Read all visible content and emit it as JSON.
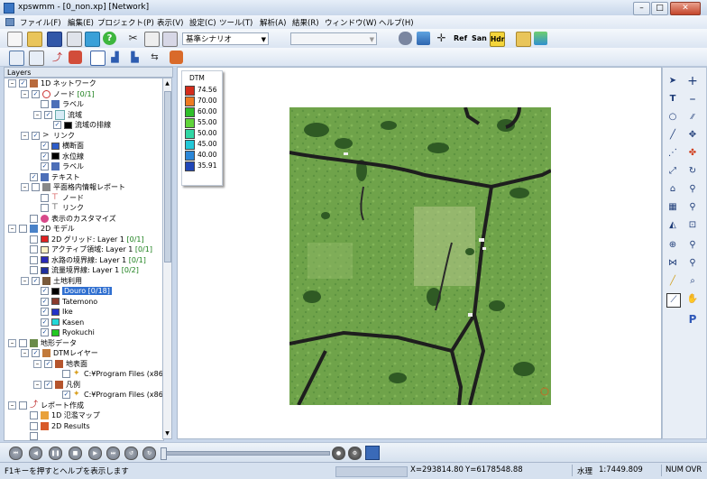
{
  "window": {
    "title": "xpswmm - [0_non.xp] [Network]",
    "minimize": "–",
    "maximize": "□",
    "close": "✕"
  },
  "menu": [
    "ファイル(F)",
    "編集(E)",
    "プロジェクト(P)",
    "表示(V)",
    "設定(C)",
    "ツール(T)",
    "解析(A)",
    "結果(R)",
    "ウィンドウ(W)",
    "ヘルプ(H)"
  ],
  "toolbar": {
    "scenario": "基準シナリオ",
    "scenario_disabled": "",
    "btn_ref": "Ref",
    "btn_san": "San",
    "btn_hdr": "Hdr"
  },
  "layers_panel": {
    "title": "Layers",
    "items": [
      {
        "label": "1D ネットワーク"
      },
      {
        "label": "ノード",
        "count": "[0/1]"
      },
      {
        "label": "ラベル"
      },
      {
        "label": "流域"
      },
      {
        "label": "流域の排線"
      },
      {
        "label": "リンク"
      },
      {
        "label": "横断面"
      },
      {
        "label": "水位線"
      },
      {
        "label": "ラベル"
      },
      {
        "label": "テキスト"
      },
      {
        "label": "平面格内情報レポート"
      },
      {
        "label": "ノード"
      },
      {
        "label": "リンク"
      },
      {
        "label": "表示のカスタマイズ"
      },
      {
        "label": "2D モデル"
      },
      {
        "label": "2D グリッド: Layer 1",
        "count": "[0/1]"
      },
      {
        "label": "アクティブ領域: Layer 1",
        "count": "[0/1]"
      },
      {
        "label": "水路の境界線: Layer 1",
        "count": "[0/1]"
      },
      {
        "label": "流量境界線: Layer 1",
        "count": "[0/2]"
      },
      {
        "label": "土地利用"
      },
      {
        "label": "Douro [0/18]"
      },
      {
        "label": "Tatemono"
      },
      {
        "label": "Ike"
      },
      {
        "label": "Kasen"
      },
      {
        "label": "Ryokuchi"
      },
      {
        "label": "地形データ"
      },
      {
        "label": "DTMレイヤー"
      },
      {
        "label": "地表面"
      },
      {
        "label": "C:¥Program Files (x86)¥XP S"
      },
      {
        "label": "凡例"
      },
      {
        "label": "C:¥Program Files (x86)¥XP S"
      },
      {
        "label": "レポート作成"
      },
      {
        "label": "1D 氾濫マップ"
      },
      {
        "label": "2D Results"
      }
    ]
  },
  "legend": {
    "title": "DTM",
    "values": [
      "74.56",
      "70.00",
      "60.00",
      "55.00",
      "50.00",
      "45.00",
      "40.00",
      "35.91"
    ],
    "colors": [
      "#d42c1c",
      "#ef7a22",
      "#2fbf2a",
      "#5fd43a",
      "#2fd6a4",
      "#22c8d8",
      "#2a86d8",
      "#2046b8"
    ]
  },
  "status": {
    "help": "F1キーを押すとヘルプを表示します",
    "x": "X=293814.80",
    "y": "Y=6178548.88",
    "scale_label": "水理",
    "scale": "1:7449.809",
    "num": "NUM",
    "ovr": "OVR"
  }
}
